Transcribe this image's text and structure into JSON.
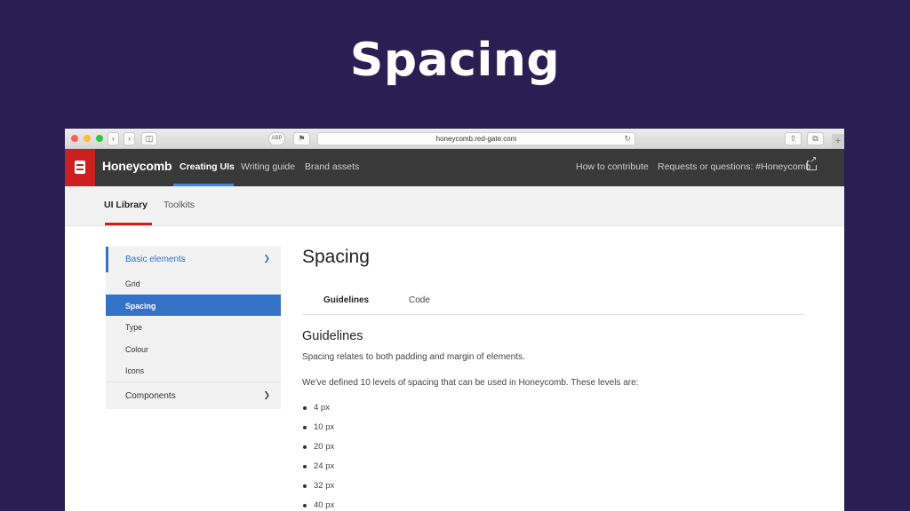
{
  "slide": {
    "title": "Spacing"
  },
  "browser": {
    "url": "honeycomb.red-gate.com",
    "privacy_badge": "ABP"
  },
  "site_nav": {
    "brand": "Honeycomb",
    "links": [
      "Creating UIs",
      "Writing guide",
      "Brand assets"
    ],
    "active_link": "Creating UIs",
    "right_links": [
      "How to contribute",
      "Requests or questions: #Honeycomb"
    ],
    "accent_color": "#3d86e0",
    "logo_color": "#cc1f1f"
  },
  "sub_nav": {
    "tabs": [
      "UI Library",
      "Toolkits"
    ],
    "active_tab": "UI Library"
  },
  "sidebar": {
    "section": "Basic elements",
    "items": [
      "Grid",
      "Spacing",
      "Type",
      "Colour",
      "Icons"
    ],
    "active_item": "Spacing",
    "collapsed_section": "Components",
    "active_color": "#3472c8"
  },
  "main": {
    "page_title": "Spacing",
    "tabs": [
      "Guidelines",
      "Code"
    ],
    "active_tab": "Guidelines",
    "section_title": "Guidelines",
    "paragraphs": [
      "Spacing relates to both padding and margin of elements.",
      "We've defined 10 levels of spacing that can be used in Honeycomb. These levels are:"
    ],
    "levels": [
      "4 px",
      "10 px",
      "20 px",
      "24 px",
      "32 px",
      "40 px"
    ]
  }
}
